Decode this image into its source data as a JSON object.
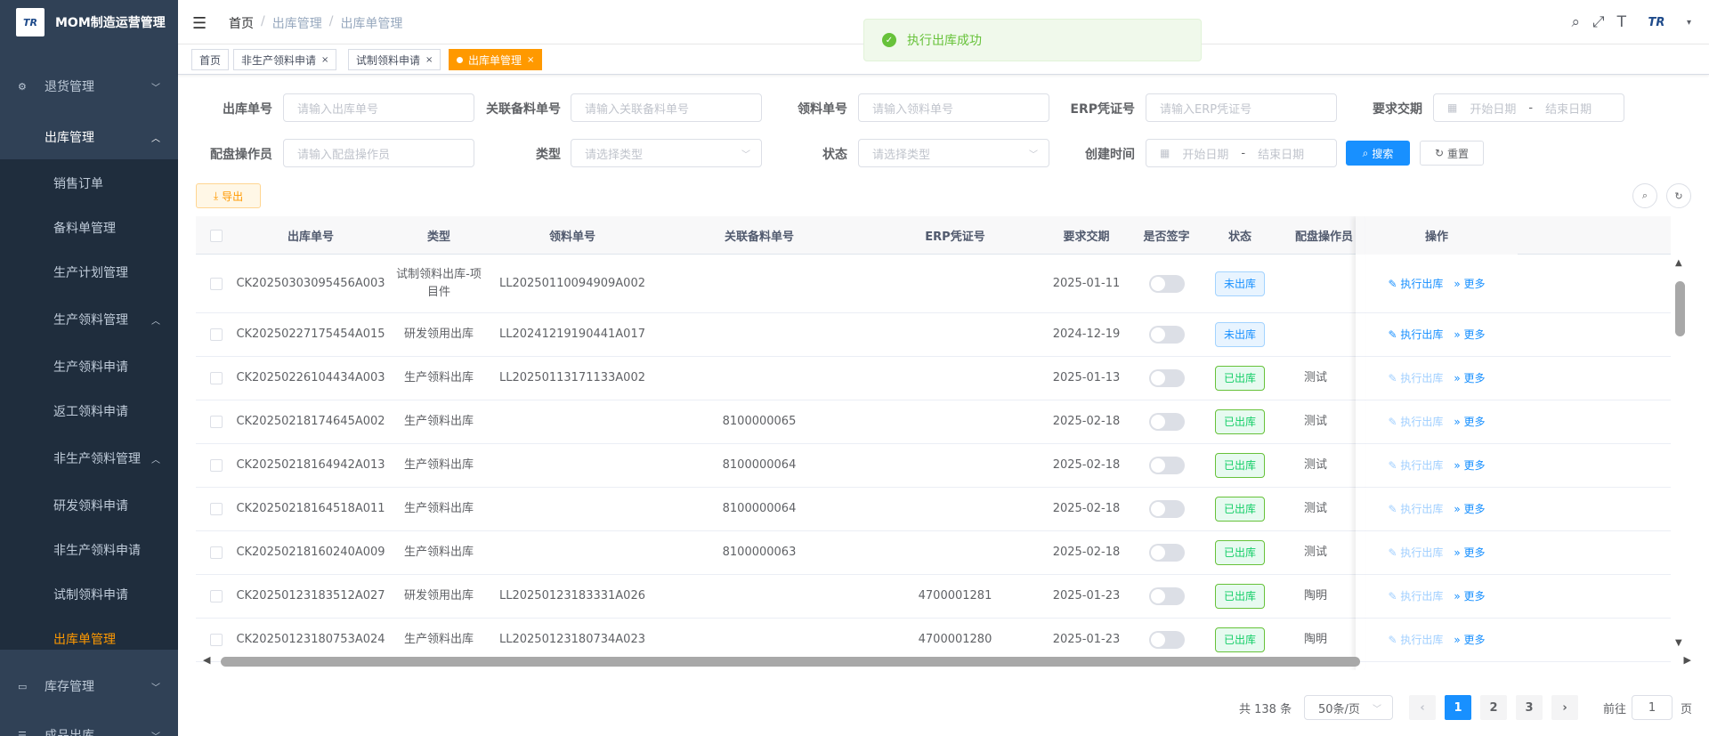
{
  "app": {
    "title": "MOM制造运营管理",
    "logo_text": "TR"
  },
  "sidebar": {
    "items": [
      {
        "label": "退货管理",
        "icon": "gear-icon"
      },
      {
        "label": "出库管理"
      },
      {
        "label": "销售订单"
      },
      {
        "label": "备料单管理"
      },
      {
        "label": "生产计划管理"
      },
      {
        "label": "生产领料管理"
      },
      {
        "label": "生产领料申请"
      },
      {
        "label": "返工领料申请"
      },
      {
        "label": "非生产领料管理"
      },
      {
        "label": "研发领料申请"
      },
      {
        "label": "非生产领料申请"
      },
      {
        "label": "试制领料申请"
      },
      {
        "label": "出库单管理"
      },
      {
        "label": "库存管理",
        "icon": "monitor-icon"
      },
      {
        "label": "成品出库",
        "icon": "list-icon"
      }
    ],
    "active_color": "#ff9900"
  },
  "header": {
    "breadcrumb": [
      "首页",
      "出库管理",
      "出库单管理"
    ],
    "breadcrumb_sep": "/",
    "user_logo": "TR"
  },
  "tabs": [
    {
      "label": "首页"
    },
    {
      "label": "非生产领料申请",
      "close": "×"
    },
    {
      "label": "试制领料申请",
      "close": "×"
    },
    {
      "label": "出库单管理",
      "close": "×"
    }
  ],
  "message": {
    "text": "执行出库成功"
  },
  "filters": {
    "f1": {
      "label": "出库单号",
      "placeholder": "请输入出库单号"
    },
    "f2": {
      "label": "关联备料单号",
      "placeholder": "请输入关联备料单号"
    },
    "f3": {
      "label": "领料单号",
      "placeholder": "请输入领料单号"
    },
    "f4": {
      "label": "ERP凭证号",
      "placeholder": "请输入ERP凭证号"
    },
    "f5": {
      "label": "要求交期",
      "start": "开始日期",
      "end": "结束日期",
      "dash": "-"
    },
    "f6": {
      "label": "配盘操作员",
      "placeholder": "请输入配盘操作员"
    },
    "f7": {
      "label": "类型",
      "placeholder": "请选择类型"
    },
    "f8": {
      "label": "状态",
      "placeholder": "请选择类型"
    },
    "f9": {
      "label": "创建时间",
      "start": "开始日期",
      "end": "结束日期",
      "dash": "-"
    },
    "search": "搜索",
    "reset": "重置",
    "export": "导出"
  },
  "table": {
    "columns": [
      "出库单号",
      "类型",
      "领料单号",
      "关联备料单号",
      "ERP凭证号",
      "要求交期",
      "是否签字",
      "状态",
      "配盘操作员",
      "操作"
    ],
    "action_exec": "执行出库",
    "action_more": "更多",
    "rows": [
      {
        "no": "CK20250303095456A003",
        "type": "试制领料出库-项目件",
        "pick": "LL20250110094909A002",
        "prep": "",
        "erp": "",
        "date": "2025-01-11",
        "status": "未出库",
        "op": "",
        "done": false
      },
      {
        "no": "CK20250227175454A015",
        "type": "研发领用出库",
        "pick": "LL20241219190441A017",
        "prep": "",
        "erp": "",
        "date": "2024-12-19",
        "status": "未出库",
        "op": "",
        "done": false
      },
      {
        "no": "CK20250226104434A003",
        "type": "生产领料出库",
        "pick": "LL20250113171133A002",
        "prep": "",
        "erp": "",
        "date": "2025-01-13",
        "status": "已出库",
        "op": "测试",
        "done": true
      },
      {
        "no": "CK20250218174645A002",
        "type": "生产领料出库",
        "pick": "",
        "prep": "8100000065",
        "erp": "",
        "date": "2025-02-18",
        "status": "已出库",
        "op": "测试",
        "done": true
      },
      {
        "no": "CK20250218164942A013",
        "type": "生产领料出库",
        "pick": "",
        "prep": "8100000064",
        "erp": "",
        "date": "2025-02-18",
        "status": "已出库",
        "op": "测试",
        "done": true
      },
      {
        "no": "CK20250218164518A011",
        "type": "生产领料出库",
        "pick": "",
        "prep": "8100000064",
        "erp": "",
        "date": "2025-02-18",
        "status": "已出库",
        "op": "测试",
        "done": true
      },
      {
        "no": "CK20250218160240A009",
        "type": "生产领料出库",
        "pick": "",
        "prep": "8100000063",
        "erp": "",
        "date": "2025-02-18",
        "status": "已出库",
        "op": "测试",
        "done": true
      },
      {
        "no": "CK20250123183512A027",
        "type": "研发领用出库",
        "pick": "LL20250123183331A026",
        "prep": "",
        "erp": "4700001281",
        "date": "2025-01-23",
        "status": "已出库",
        "op": "陶明",
        "done": true
      },
      {
        "no": "CK20250123180753A024",
        "type": "生产领料出库",
        "pick": "LL20250123180734A023",
        "prep": "",
        "erp": "4700001280",
        "date": "2025-01-23",
        "status": "已出库",
        "op": "陶明",
        "done": true
      }
    ]
  },
  "pagination": {
    "total": "共 138 条",
    "size": "50条/页",
    "pages": [
      "1",
      "2",
      "3"
    ],
    "current": "1",
    "goto_label": "前往",
    "goto_value": "1",
    "page_unit": "页"
  }
}
